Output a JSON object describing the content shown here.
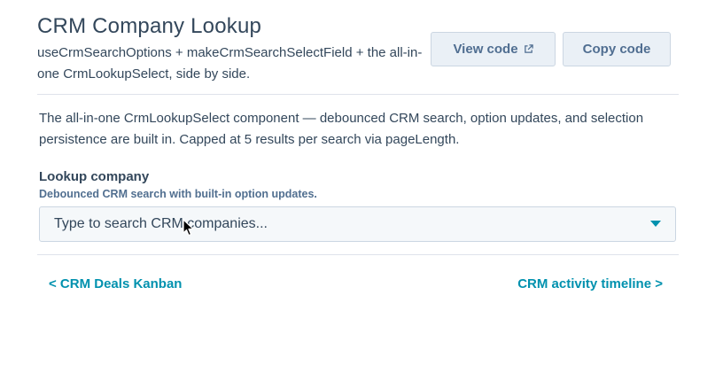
{
  "header": {
    "title": "CRM Company Lookup",
    "subtitle": "useCrmSearchOptions + makeCrmSearchSelectField + the all-in-one CrmLookupSelect, side by side."
  },
  "toolbar": {
    "view_code_label": "View code",
    "view_code_icon": "external-link-icon",
    "copy_code_label": "Copy code"
  },
  "main": {
    "description": "The all-in-one CrmLookupSelect component — debounced CRM search, option updates, and selection persistence are built in. Capped at 5 results per search via pageLength.",
    "lookup": {
      "label": "Lookup company",
      "help_text": "Debounced CRM search with built-in option updates.",
      "placeholder": "Type to search CRM companies...",
      "dropdown_icon": "caret-down-icon"
    }
  },
  "footer_nav": {
    "prev_label": "< CRM Deals Kanban",
    "next_label": "CRM activity timeline >"
  },
  "colors": {
    "text": "#33475b",
    "accent": "#0091ae",
    "button_bg": "#eaf0f6",
    "button_text": "#506e91",
    "divider": "#dfe3eb"
  }
}
